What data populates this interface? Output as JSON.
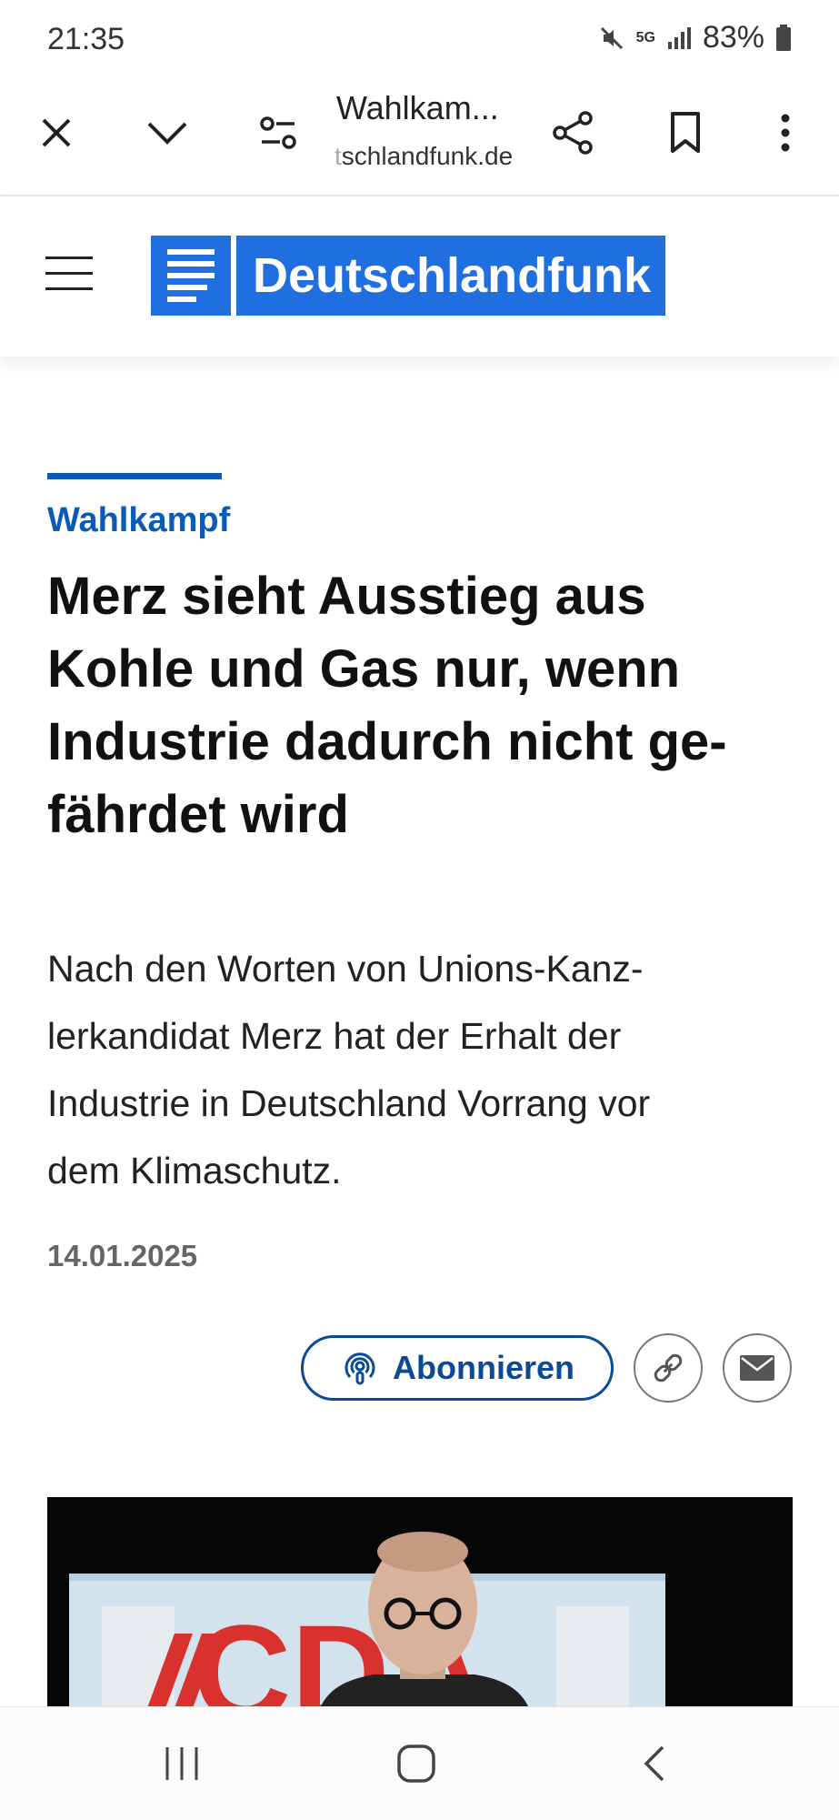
{
  "status_bar": {
    "time": "21:35",
    "network": "5G",
    "battery": "83%"
  },
  "browser": {
    "title": "Wahlkam...",
    "url_faded": "t",
    "url": "schlandfunk.de"
  },
  "site": {
    "logo_text": "Deutschlandfunk",
    "brand_color": "#1f6fe0"
  },
  "article": {
    "kicker": "Wahlkampf",
    "headline_lines": [
      "Merz sieht Ausstieg aus",
      "Kohle und Gas nur, wenn",
      "Industrie dadurch nicht ge-",
      "fährdet wird"
    ],
    "lead_lines": [
      "Nach den Worten von Unions-Kanz-",
      "lerkandidat Merz hat der Erhalt der",
      "Industrie in Deutschland Vorrang vor",
      "dem Klimaschutz."
    ],
    "date": "14.01.2025",
    "accent_color": "#0b5bb5"
  },
  "actions": {
    "subscribe_label": "Abonnieren"
  },
  "photo": {
    "banner_text": "CDA"
  }
}
